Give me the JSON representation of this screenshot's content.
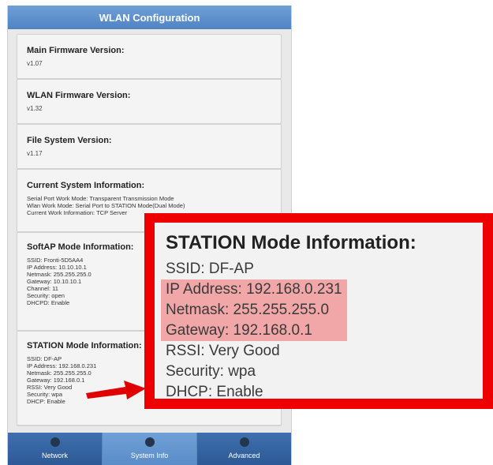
{
  "header": {
    "title": "WLAN Configuration"
  },
  "sections": {
    "main_firmware": {
      "title": "Main Firmware Version:",
      "value": "v1.07"
    },
    "wlan_firmware": {
      "title": "WLAN Firmware Version:",
      "value": "v1.32"
    },
    "file_system": {
      "title": "File System Version:",
      "value": "v1.17"
    },
    "current_system": {
      "title": "Current System Information:",
      "lines": [
        "Serial Port Work Mode: Transparent Transmission Mode",
        "Wlan Work Mode: Serial Port to STATION Mode(Dual Mode)",
        "Current Work Information: TCP Server"
      ]
    },
    "softap": {
      "title": "SoftAP Mode Information:",
      "lines": [
        "SSID: Fronti-5D5AA4",
        "IP Address: 10.10.10.1",
        "Netmask: 255.255.255.0",
        "Gateway: 10.10.10.1",
        "Channel: 11",
        "Security: open",
        "DHCPD: Enable"
      ]
    },
    "station": {
      "title": "STATION Mode Information:",
      "lines": [
        "SSID: DF-AP",
        "IP Address: 192.168.0.231",
        "Netmask: 255.255.255.0",
        "Gateway: 192.168.0.1",
        "RSSI: Very Good",
        "Security: wpa",
        "DHCP: Enable"
      ]
    }
  },
  "tabs": [
    {
      "label": "Network"
    },
    {
      "label": "System Info"
    },
    {
      "label": "Advanced"
    }
  ],
  "zoom": {
    "title": "STATION Mode Information:",
    "lines": [
      "SSID: DF-AP",
      "IP Address: 192.168.0.231",
      "Netmask: 255.255.255.0",
      "Gateway: 192.168.0.1",
      "RSSI: Very Good",
      "Security: wpa",
      "DHCP: Enable"
    ]
  },
  "colors": {
    "header_bg": "#5b8fcc",
    "tabbar_bg": "#3a6aa8",
    "callout_border": "#ee0000",
    "highlight": "#f1a7a7",
    "arrow": "#e00000"
  },
  "icons": {
    "tab_icon": "dot-icon",
    "pointer": "arrow-right-icon"
  }
}
